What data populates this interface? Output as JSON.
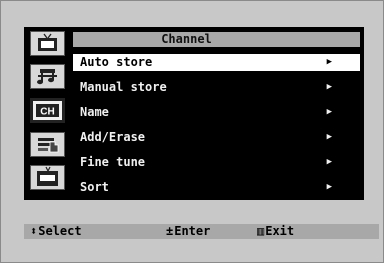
{
  "menu": {
    "title": "Channel",
    "items": [
      {
        "label": "Auto store",
        "arrow": "▶"
      },
      {
        "label": "Manual store",
        "arrow": "▶"
      },
      {
        "label": "Name",
        "arrow": "▶"
      },
      {
        "label": "Add/Erase",
        "arrow": "▶"
      },
      {
        "label": "Fine tune",
        "arrow": "▶"
      },
      {
        "label": "Sort",
        "arrow": "▶"
      }
    ]
  },
  "sidebar": {
    "icons": [
      "picture-tv-icon",
      "sound-icon",
      "channel-icon",
      "setup-icon",
      "input-tv-icon"
    ],
    "channel_icon_text": "CH"
  },
  "footer": {
    "select_glyph": "⬍",
    "select_label": "Select",
    "enter_glyph": "±",
    "enter_label": "Enter",
    "exit_glyph": "▥",
    "exit_label": "Exit"
  },
  "colors": {
    "background": "#c8c8c8",
    "panel": "#000000",
    "header_bar": "#a8a8a8",
    "selected_row": "#ffffff"
  }
}
